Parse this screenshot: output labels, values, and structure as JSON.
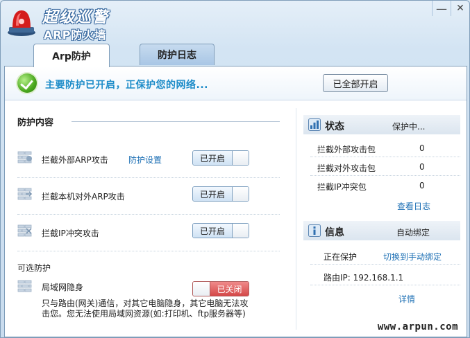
{
  "app": {
    "title_line1": "超级巡警",
    "title_line2": "ARP防火墙"
  },
  "window_controls": {
    "minimize": "—",
    "close": "✕"
  },
  "tabs": [
    {
      "label": "Arp防护",
      "active": true
    },
    {
      "label": "防护日志",
      "active": false
    }
  ],
  "banner": {
    "message": "主要防护已开启，正保护您的网络...",
    "all_on_button": "已全部开启"
  },
  "protection": {
    "section_title": "防护内容",
    "rows": [
      {
        "label": "拦截外部ARP攻击",
        "link": "防护设置",
        "toggle": "已开启"
      },
      {
        "label": "拦截本机对外ARP攻击",
        "toggle": "已开启"
      },
      {
        "label": "拦截IP冲突攻击",
        "toggle": "已开启"
      }
    ],
    "optional_title": "可选防护",
    "stealth": {
      "label": "局域网隐身",
      "toggle": "已关闭",
      "description": "只与路由(网关)通信，对其它电脑隐身，其它电脑无法攻击您。您无法使用局域网资源(如:打印机、ftp服务器等)"
    }
  },
  "status": {
    "title": "状态",
    "state": "保护中...",
    "items": [
      {
        "label": "拦截外部攻击包",
        "value": "0"
      },
      {
        "label": "拦截对外攻击包",
        "value": "0"
      },
      {
        "label": "拦截IP冲突包",
        "value": "0"
      }
    ],
    "view_log_link": "查看日志"
  },
  "info": {
    "title": "信息",
    "mode": "自动绑定",
    "protecting_label": "正在保护",
    "switch_link": "切换到手动绑定",
    "router_ip": "路由IP: 192.168.1.1",
    "details_link": "详情"
  },
  "watermark": "www.arpun.com",
  "colors": {
    "accent_blue": "#1b8bc8",
    "link_blue": "#1c6fb4",
    "off_red": "#d44848"
  }
}
